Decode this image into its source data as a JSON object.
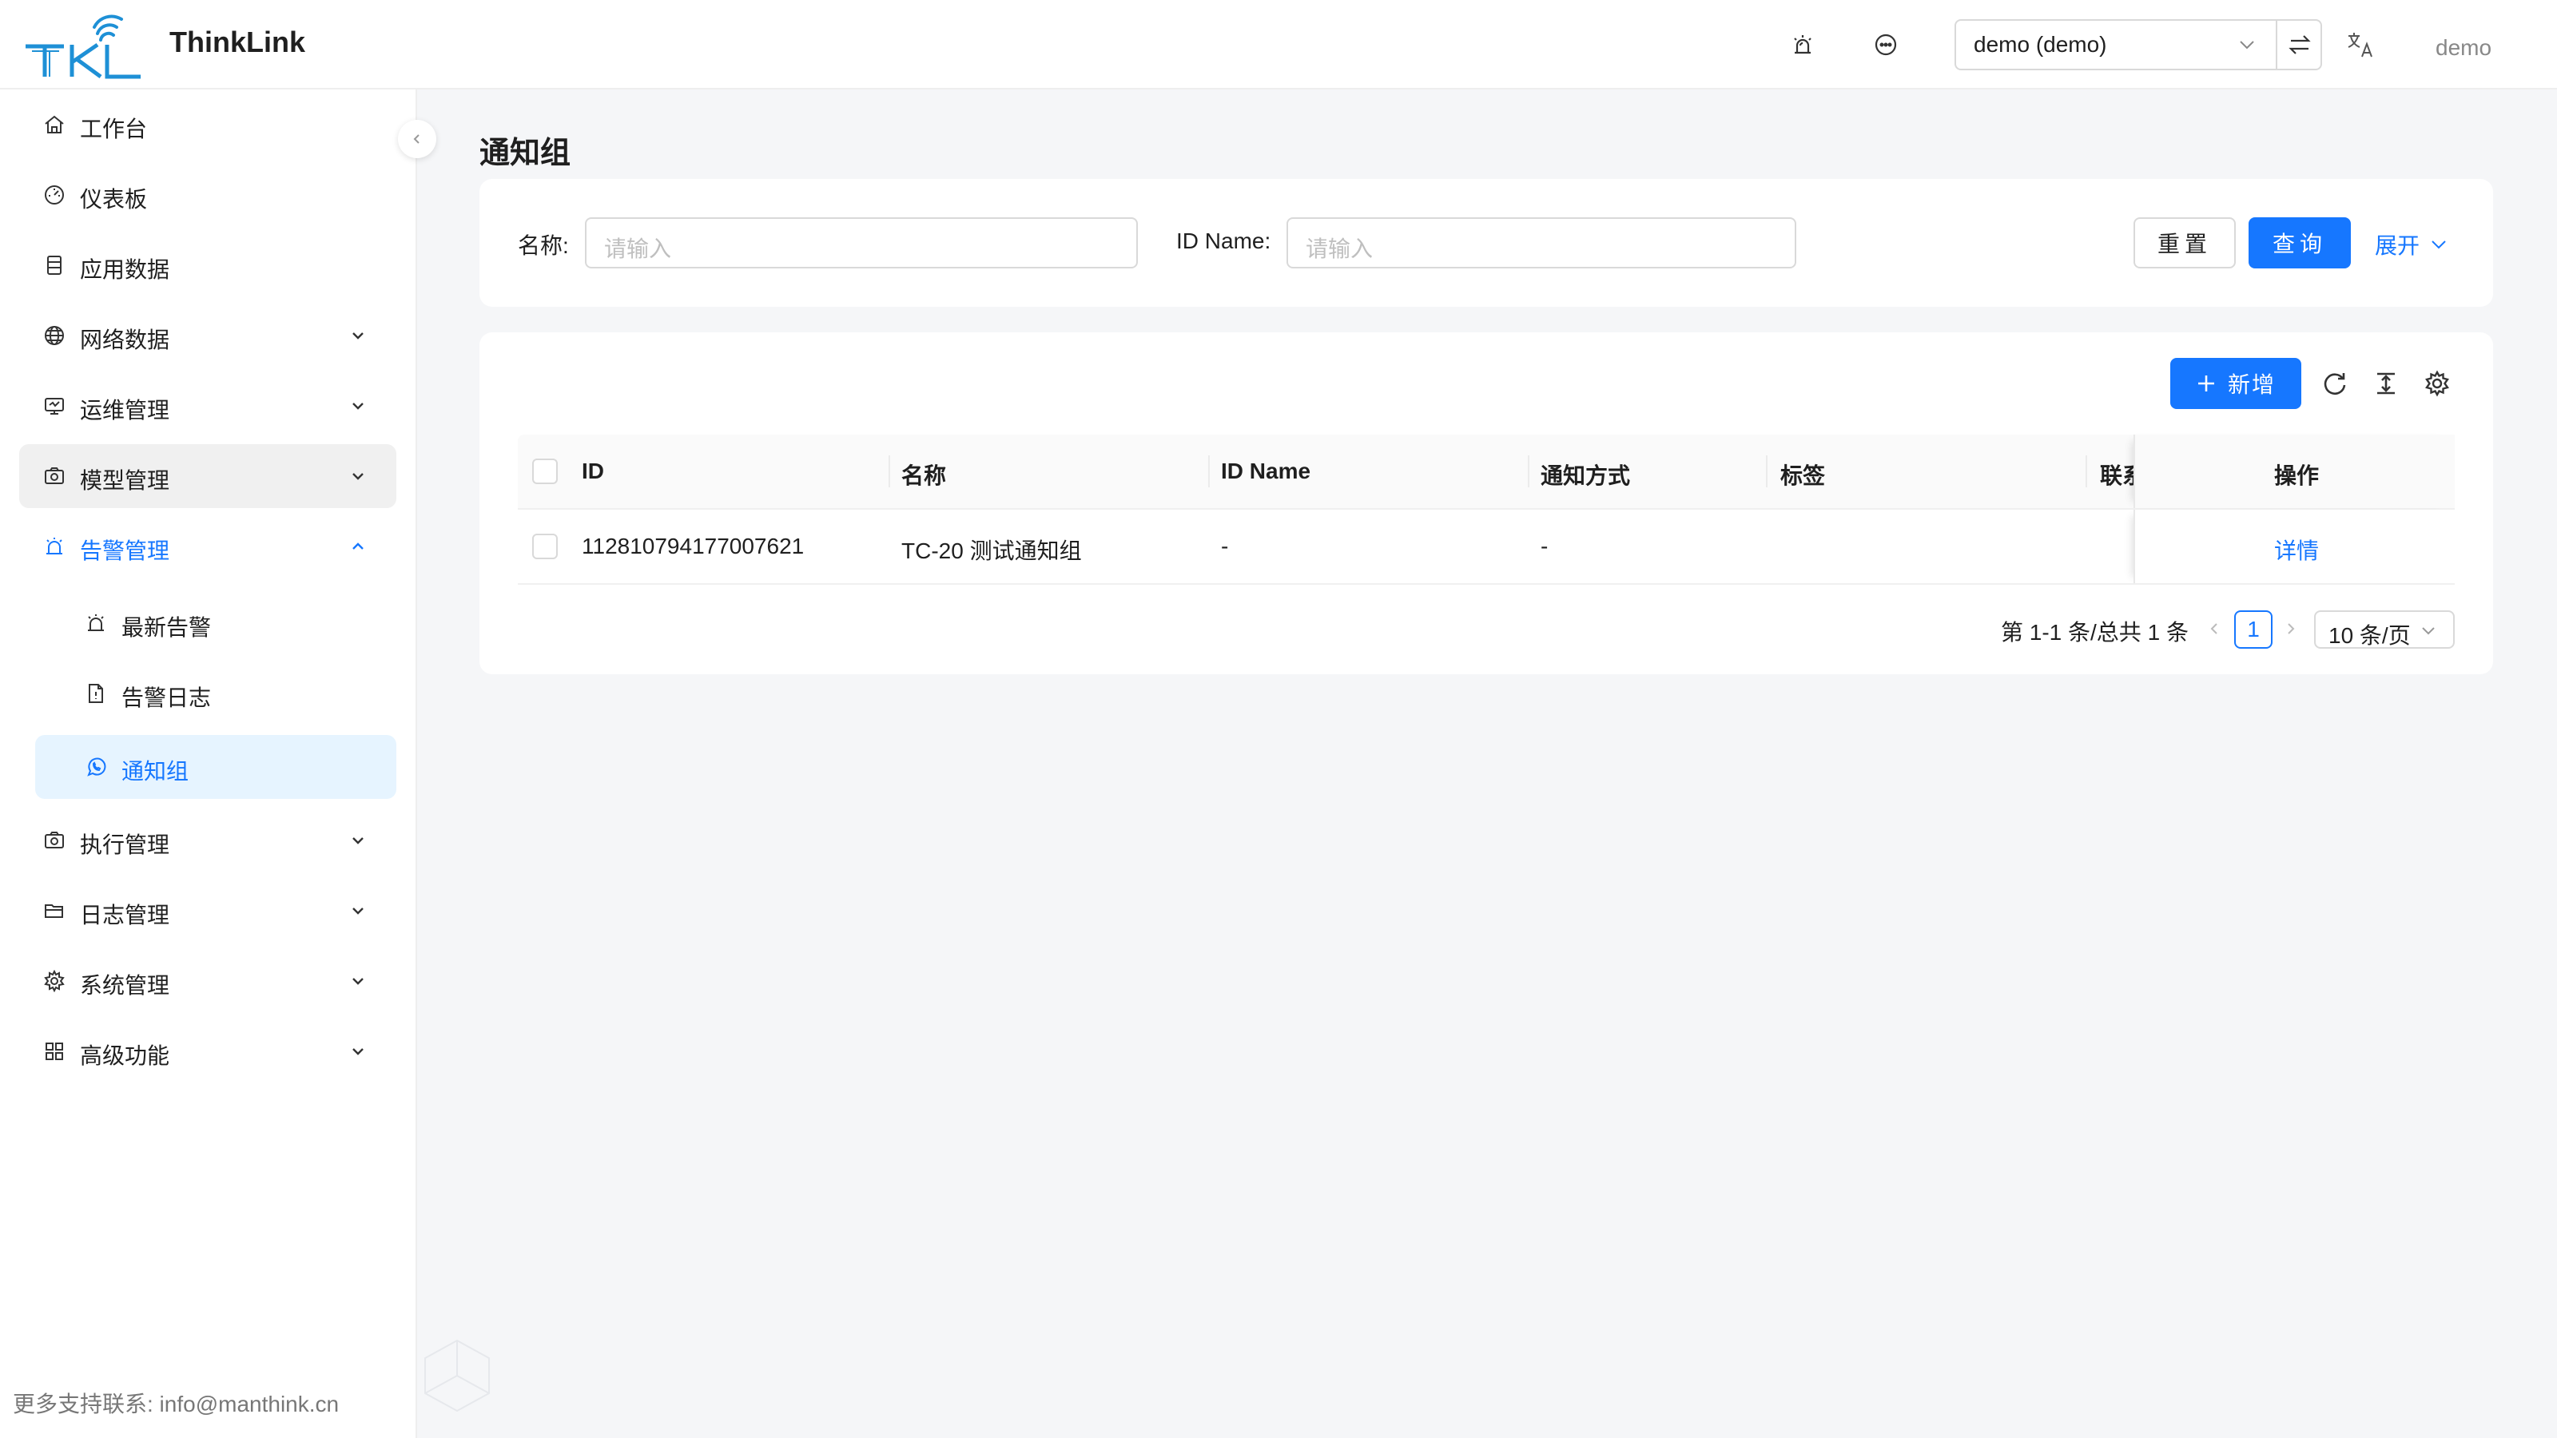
{
  "header": {
    "brand": "ThinkLink",
    "tenant_value": "demo (demo)",
    "user": "demo",
    "icons": [
      "alarm-icon",
      "message-icon",
      "chevron-down-icon",
      "swap-icon",
      "translate-icon"
    ]
  },
  "sidebar": {
    "items": [
      {
        "label": "工作台",
        "icon": "home-icon"
      },
      {
        "label": "仪表板",
        "icon": "dashboard-icon"
      },
      {
        "label": "应用数据",
        "icon": "database-icon"
      },
      {
        "label": "网络数据",
        "icon": "globe-icon"
      },
      {
        "label": "运维管理",
        "icon": "monitor-icon"
      },
      {
        "label": "模型管理",
        "icon": "camera-box-icon"
      },
      {
        "label": "告警管理",
        "icon": "alarm-icon"
      },
      {
        "label": "最新告警",
        "icon": "alarm-icon"
      },
      {
        "label": "告警日志",
        "icon": "file-icon"
      },
      {
        "label": "通知组",
        "icon": "whatsapp-icon"
      },
      {
        "label": "执行管理",
        "icon": "camera-box-icon"
      },
      {
        "label": "日志管理",
        "icon": "folder-icon"
      },
      {
        "label": "系统管理",
        "icon": "gear-icon"
      },
      {
        "label": "高级功能",
        "icon": "apps-icon"
      }
    ],
    "support": "更多支持联系: info@manthink.cn"
  },
  "page": {
    "title": "通知组"
  },
  "search": {
    "name_label": "名称:",
    "name_placeholder": "请输入",
    "idname_label": "ID Name:",
    "idname_placeholder": "请输入",
    "reset": "重置",
    "query": "查询",
    "expand": "展开"
  },
  "table": {
    "add": "新增",
    "columns": [
      "ID",
      "名称",
      "ID Name",
      "通知方式",
      "标签",
      "联系",
      "操作"
    ],
    "rows": [
      {
        "id": "112810794177007621",
        "name": "TC-20 测试通知组",
        "id_name": "-",
        "method": "-",
        "tags": "",
        "action": "详情"
      }
    ]
  },
  "pagination": {
    "total_text": "第 1-1 条/总共 1 条",
    "current_page": "1",
    "page_size": "10 条/页"
  },
  "colors": {
    "primary": "#1677ff",
    "selected_bg": "#e6f4ff"
  }
}
